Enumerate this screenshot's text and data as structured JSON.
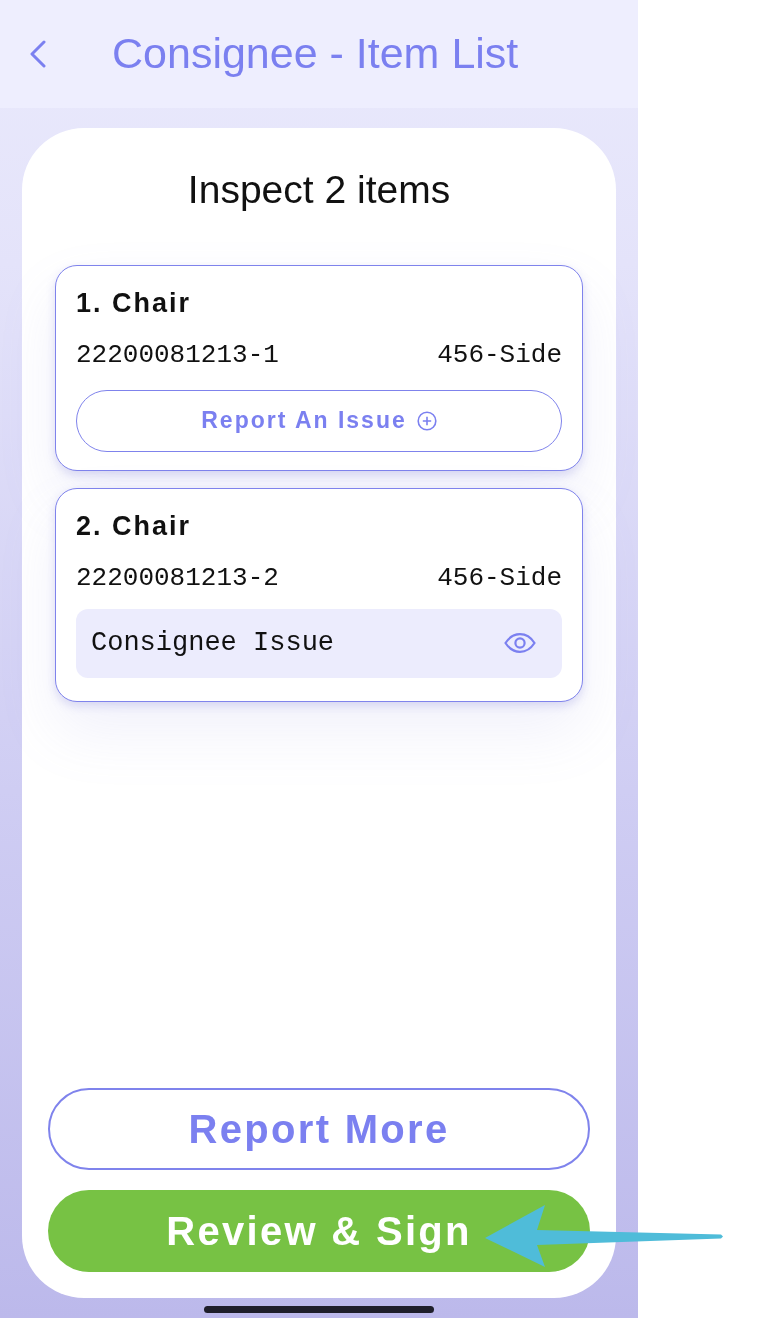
{
  "header": {
    "title": "Consignee - Item List"
  },
  "list": {
    "heading": "Inspect 2 items"
  },
  "items": [
    {
      "kind": "report",
      "title": "1. Chair",
      "code": "22200081213-1",
      "location": "456-Side",
      "action": "Report An Issue"
    },
    {
      "kind": "issue",
      "title": "2. Chair",
      "code": "22200081213-2",
      "location": "456-Side",
      "issue": "Consignee Issue"
    }
  ],
  "buttons": [
    {
      "kind": "outline",
      "label": "Report More"
    },
    {
      "kind": "primary",
      "label": "Review & Sign"
    }
  ],
  "annotations": [
    {
      "kind": "arrow"
    }
  ]
}
